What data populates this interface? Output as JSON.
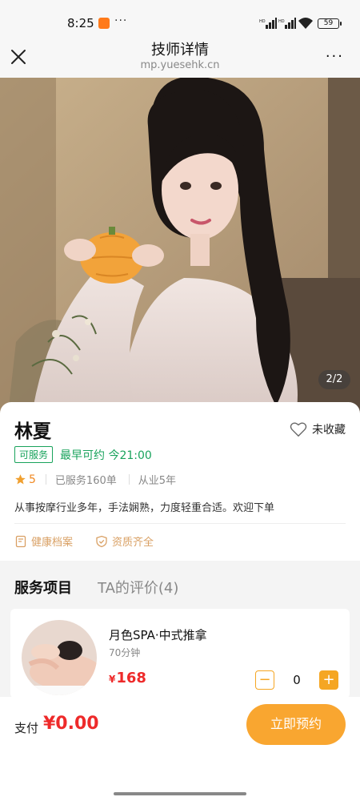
{
  "status_bar": {
    "time": "8:25",
    "more": "···",
    "battery": "59"
  },
  "nav": {
    "title": "技师详情",
    "url": "mp.yuesehk.cn",
    "more": "···"
  },
  "photo": {
    "counter": "2/2"
  },
  "technician": {
    "name": "林夏",
    "favorite_label": "未收藏",
    "availability_badge": "可服务",
    "earliest_time": "最早可约 今21:00",
    "rating": "5",
    "served": "已服务160单",
    "experience": "从业5年",
    "intro": "从事按摩行业多年，手法娴熟，力度轻重合适。欢迎下单",
    "health_record": "健康档案",
    "qualification": "资质齐全"
  },
  "tabs": [
    {
      "label": "服务项目"
    },
    {
      "label": "TA的评价(4)"
    }
  ],
  "service": {
    "name": "月色SPA·中式推拿",
    "duration": "70分钟",
    "currency": "¥",
    "price": "168",
    "minus": "−",
    "quantity": "0",
    "plus": "+"
  },
  "payment": {
    "label": "支付",
    "amount": "¥0.00",
    "button": "立即预约"
  },
  "colors": {
    "accent": "#f9a630",
    "price": "#ee2a2a",
    "green": "#19a35c",
    "gold": "#d9a064"
  }
}
